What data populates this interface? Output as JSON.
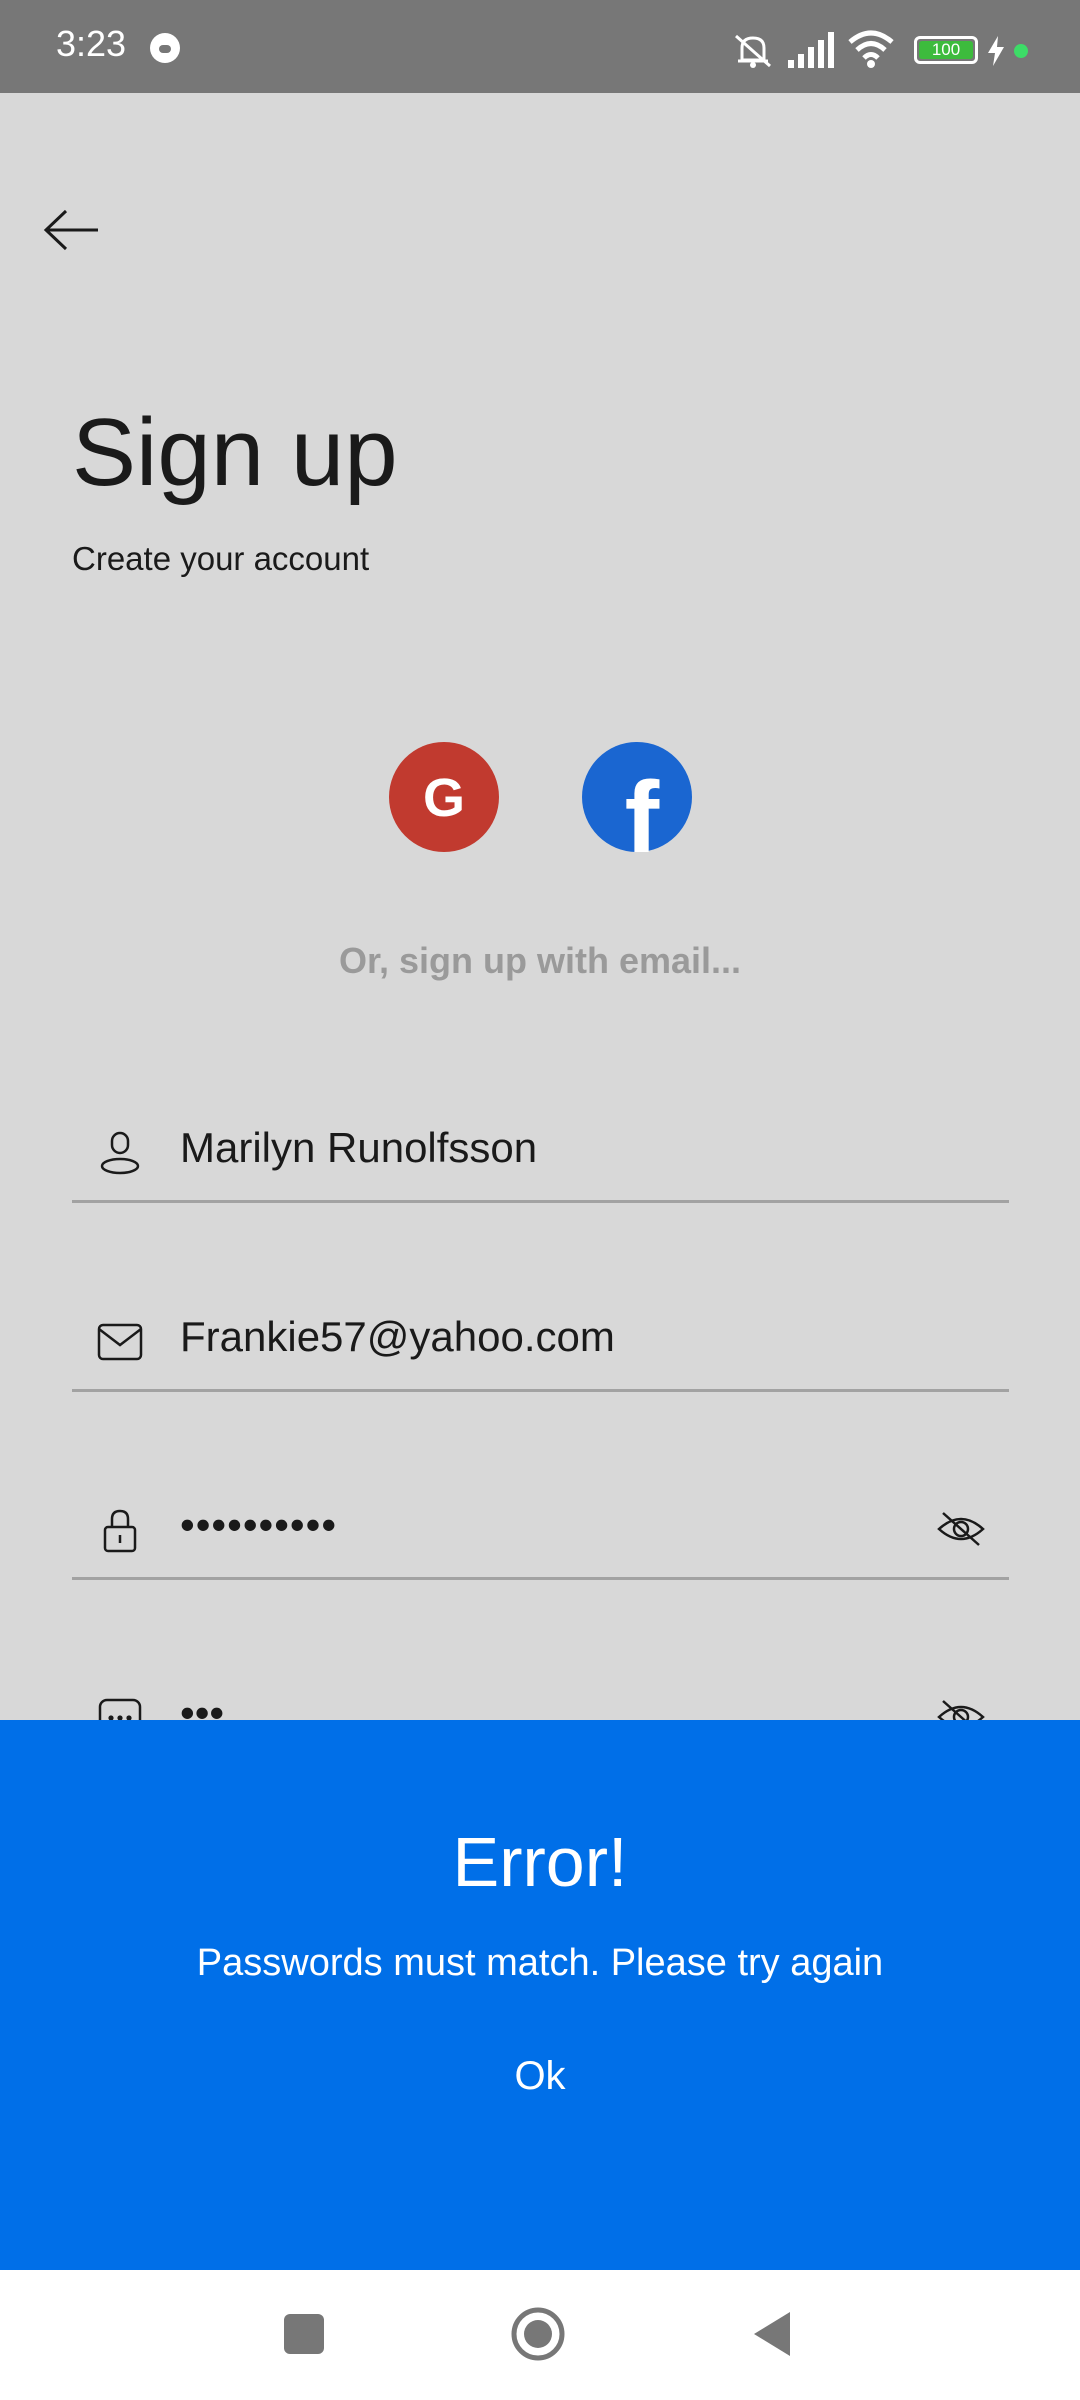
{
  "status_bar": {
    "time": "3:23",
    "battery": "100",
    "icons": [
      "app-notification-icon",
      "mute-icon",
      "signal-icon",
      "wifi-icon",
      "battery-icon",
      "charging-icon"
    ]
  },
  "header": {
    "back_icon": "arrow-left-icon",
    "title": "Sign up",
    "subtitle": "Create your account"
  },
  "social": {
    "google_letter": "G",
    "facebook_letter": "f",
    "divider": "Or, sign up with email..."
  },
  "form": {
    "name": {
      "icon": "user-icon",
      "value": "Marilyn Runolfsson"
    },
    "email": {
      "icon": "mail-icon",
      "value": "Frankie57@yahoo.com"
    },
    "password": {
      "icon": "lock-icon",
      "value": "••••••••••"
    },
    "confirm_password": {
      "icon": "dots-box-icon",
      "value": "•••"
    }
  },
  "error_dialog": {
    "title": "Error!",
    "message": "Passwords must match. Please try again",
    "ok_label": "Ok"
  },
  "colors": {
    "background": "#d8d8d8",
    "status_bar": "#777777",
    "dialog": "#006fe8",
    "google": "#c13a2f",
    "facebook": "#1a66d1"
  }
}
